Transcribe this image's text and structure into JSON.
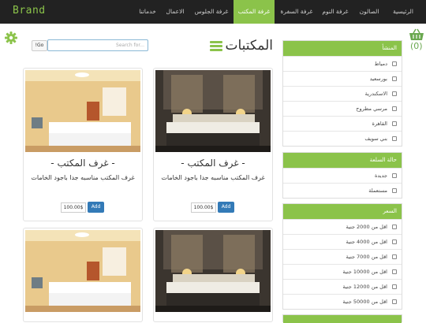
{
  "navbar": {
    "brand": "Brand",
    "items": [
      {
        "label": "الرئيسية"
      },
      {
        "label": "الصالون"
      },
      {
        "label": "غرفة النوم"
      },
      {
        "label": "غرفة السفرة"
      },
      {
        "label": "غرفة المكتب"
      },
      {
        "label": "غرفة الجلوس"
      },
      {
        "label": "الاعمال"
      },
      {
        "label": "خدماتنا"
      }
    ],
    "active_index": 4
  },
  "cart": {
    "count": "(0)"
  },
  "search": {
    "placeholder": "Search for...",
    "button": "!Go"
  },
  "page_title": "المكتبات",
  "filters": {
    "origin": {
      "title": "المنشأ",
      "options": [
        "دمياط",
        "بورسعيد",
        "الاسكندرية",
        "مرسي مطروح",
        "القاهرة",
        "بني سويف"
      ]
    },
    "condition": {
      "title": "حالة السلعة",
      "options": [
        "جديدة",
        "مستعملة"
      ]
    },
    "price": {
      "title": "السعر",
      "options": [
        "اقل من 2000 جنية",
        "اقل من 4000 جنية",
        "اقل من 7000 جنية",
        "اقل من 10000 جنية",
        "اقل من 12000 جنية",
        "اقل من 50000 جنية"
      ]
    }
  },
  "products": [
    {
      "title": "- غرف المكتب -",
      "description": "غرف المكتب مناسبه جدا باجود الخامات",
      "price": "100.00$",
      "add_label": "Add"
    },
    {
      "title": "- غرف المكتب -",
      "description": "غرف المكتب مناسبه جدا باجود الخامات",
      "price": "100.00$",
      "add_label": "Add"
    }
  ],
  "colors": {
    "accent": "#8bc34a",
    "navbar": "#222222",
    "add_button": "#337ab7"
  },
  "icons": {
    "cart": "basket-icon",
    "settings": "gear-icon",
    "menu": "hamburger-icon"
  }
}
